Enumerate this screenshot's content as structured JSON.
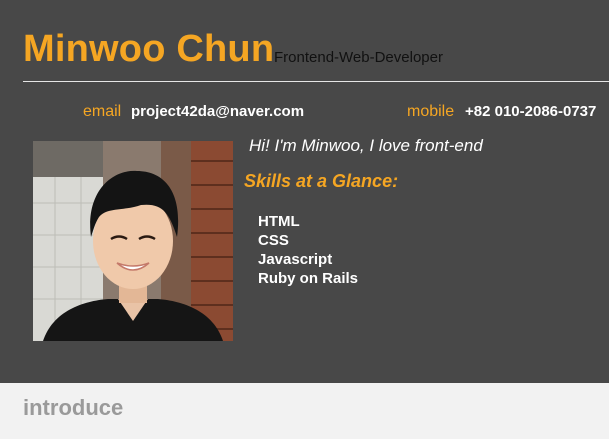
{
  "header": {
    "name": "Minwoo Chun",
    "role": "Frontend-Web-Developer"
  },
  "contact": {
    "email_label": "email",
    "email_value": "project42da@naver.com",
    "mobile_label": "mobile",
    "mobile_value": "+82 010-2086-0737"
  },
  "profile": {
    "greeting": "Hi! I'm Minwoo, I love front-end",
    "skills_title": "Skills at a Glance:",
    "skills": [
      "HTML",
      "CSS",
      "Javascript",
      "Ruby on Rails"
    ]
  },
  "introduce": {
    "title": "introduce",
    "text": ""
  },
  "colors": {
    "header_bg": "#484848",
    "accent": "#f5a623",
    "page_bg": "#f2f2f2"
  }
}
